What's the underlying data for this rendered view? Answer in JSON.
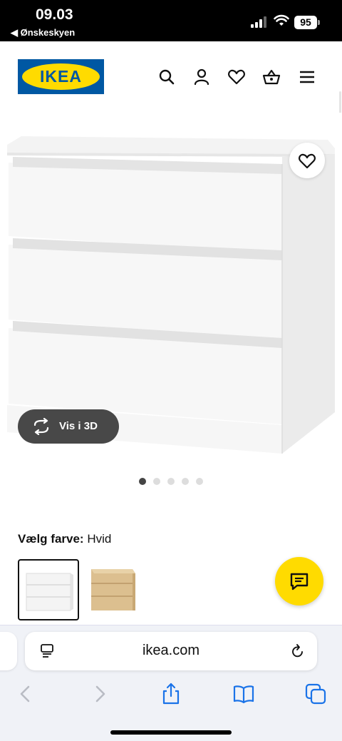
{
  "status_bar": {
    "time": "09.03",
    "back_app": "◀ Ønskeskyen",
    "battery": "95"
  },
  "header": {
    "logo_text": "IKEA",
    "icons": [
      "search-icon",
      "account-icon",
      "heart-icon",
      "basket-icon",
      "menu-icon"
    ],
    "brand_blue": "#0058a3",
    "brand_yellow": "#ffdb00"
  },
  "gallery": {
    "vis3d_label": "Vis i 3D",
    "dot_count": 5,
    "active_dot": 0
  },
  "color_select": {
    "label": "Vælg farve:",
    "value": "Hvid",
    "options": [
      "white",
      "oak"
    ]
  },
  "safari": {
    "url": "ikea.com"
  }
}
